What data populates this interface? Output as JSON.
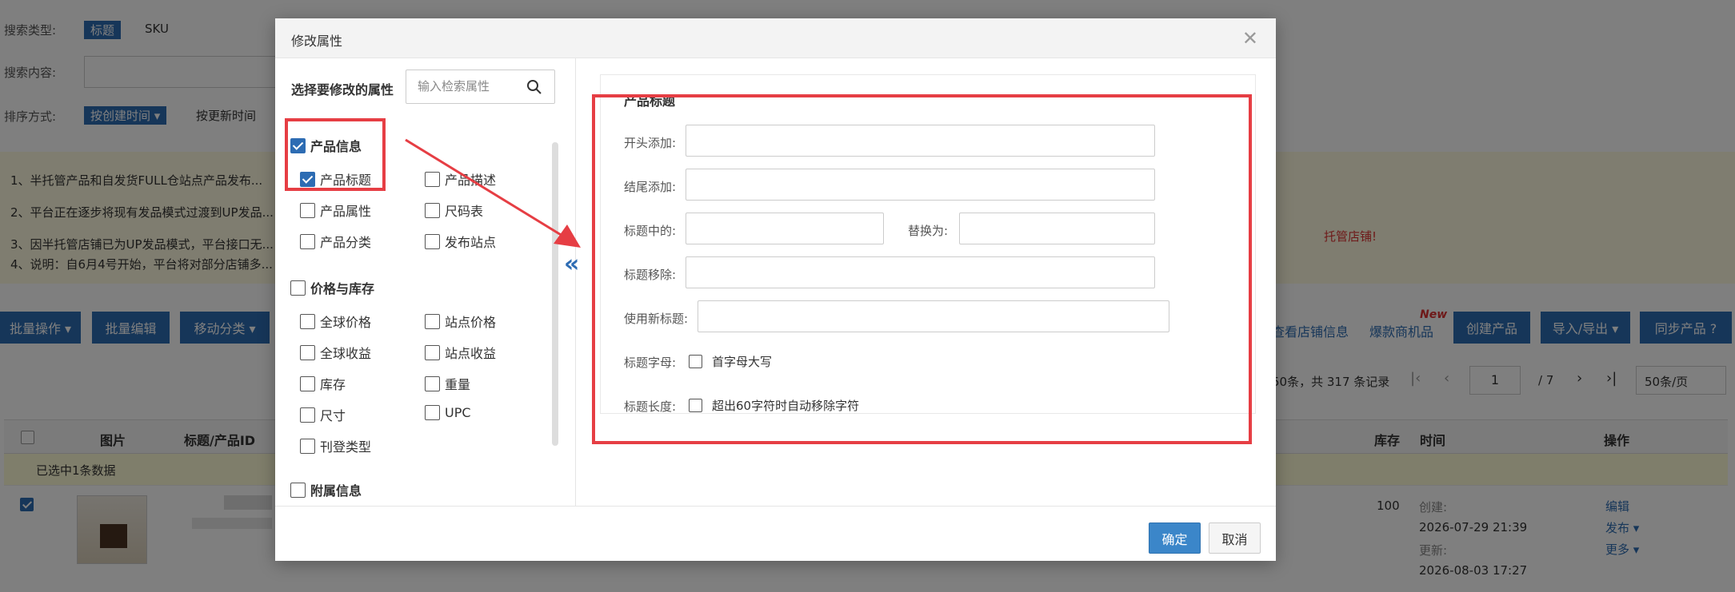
{
  "background": {
    "search_type_label": "搜索类型:",
    "search_type_options": [
      "标题",
      "SKU"
    ],
    "search_content_label": "搜索内容:",
    "sort_label": "排序方式:",
    "sort_options": [
      "按创建时间 ▾",
      "按更新时间"
    ],
    "notices": [
      "1、半托管产品和自发货FULL仓站点产品发布...",
      "2、平台正在逐步将现有发品模式过渡到UP发品...",
      "3、因半托管店铺已为UP发品模式，平台接口无...",
      "4、说明：自6月4号开始，平台将对部分店铺多..."
    ],
    "notice_tail": "托管店铺!",
    "toolbar_buttons": [
      "批量操作 ▾",
      "批量编辑",
      "移动分类 ▾"
    ],
    "toolbar_right": {
      "view_store": "查看店铺信息",
      "hot_products": "爆款商机品",
      "new_badge": "New",
      "create": "创建产品",
      "import_export": "导入/导出 ▾",
      "sync": "同步产品 ?"
    },
    "pagination": {
      "summary": "50条，共 317 条记录",
      "page": "1",
      "total": "/ 7",
      "page_size": "50条/页"
    },
    "table_headers": [
      "图片",
      "标题/产品ID",
      "库存",
      "时间",
      "操作"
    ],
    "selected_text": "已选中1条数据",
    "row": {
      "stock": "100",
      "created_label": "创建:",
      "created": "2026-07-29 21:39",
      "updated_label": "更新:",
      "updated": "2026-08-03 17:27",
      "actions": [
        "编辑",
        "发布 ▾",
        "更多 ▾"
      ]
    }
  },
  "modal": {
    "title": "修改属性",
    "select_label": "选择要修改的属性",
    "search_placeholder": "输入检索属性",
    "groups": [
      {
        "label": "产品信息",
        "checked": true,
        "items": [
          {
            "label": "产品标题",
            "checked": true
          },
          {
            "label": "产品描述",
            "checked": false
          },
          {
            "label": "产品属性",
            "checked": false
          },
          {
            "label": "尺码表",
            "checked": false
          },
          {
            "label": "产品分类",
            "checked": false
          },
          {
            "label": "发布站点",
            "checked": false
          }
        ]
      },
      {
        "label": "价格与库存",
        "checked": false,
        "items": [
          {
            "label": "全球价格",
            "checked": false
          },
          {
            "label": "站点价格",
            "checked": false
          },
          {
            "label": "全球收益",
            "checked": false
          },
          {
            "label": "站点收益",
            "checked": false
          },
          {
            "label": "库存",
            "checked": false
          },
          {
            "label": "重量",
            "checked": false
          },
          {
            "label": "尺寸",
            "checked": false
          },
          {
            "label": "UPC",
            "checked": false
          },
          {
            "label": "刊登类型",
            "checked": false
          }
        ]
      },
      {
        "label": "附属信息",
        "checked": false,
        "items": []
      }
    ],
    "collapse_icon": "«",
    "form": {
      "section_title": "产品标题",
      "prefix_label": "开头添加:",
      "suffix_label": "结尾添加:",
      "replace_from_label": "标题中的:",
      "replace_to_label": "替换为:",
      "remove_label": "标题移除:",
      "new_title_label": "使用新标题:",
      "case_label": "标题字母:",
      "case_option": "首字母大写",
      "length_label": "标题长度:",
      "length_option": "超出60字符时自动移除字符"
    },
    "ok": "确定",
    "cancel": "取消"
  },
  "colors": {
    "accent": "#2d6cb3",
    "highlight": "#e63e44"
  }
}
